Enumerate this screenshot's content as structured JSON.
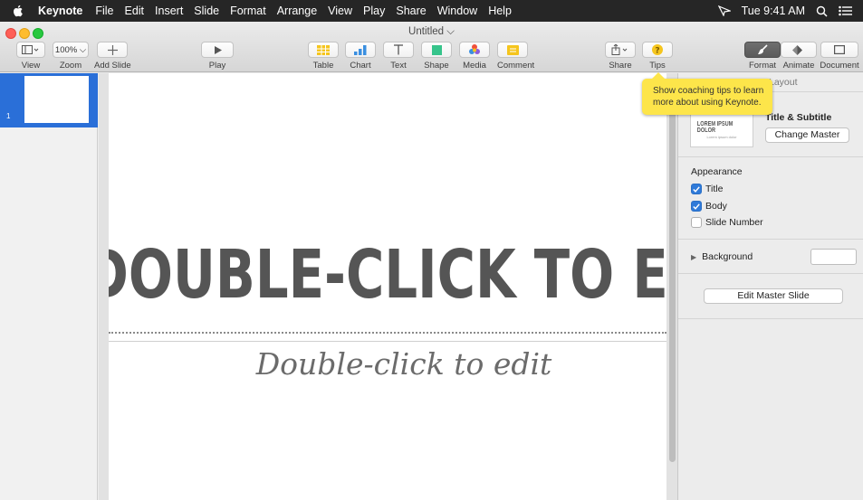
{
  "menubar": {
    "items": [
      "Keynote",
      "File",
      "Edit",
      "Insert",
      "Slide",
      "Format",
      "Arrange",
      "View",
      "Play",
      "Share",
      "Window",
      "Help"
    ],
    "clock": "Tue 9:41 AM"
  },
  "window": {
    "title": "Untitled ⌵"
  },
  "toolbar": {
    "view_label": "View",
    "zoom_value": "100% ⌵",
    "zoom_label": "Zoom",
    "add_slide_label": "Add Slide",
    "play_label": "Play",
    "table_label": "Table",
    "chart_label": "Chart",
    "text_label": "Text",
    "shape_label": "Shape",
    "media_label": "Media",
    "comment_label": "Comment",
    "share_label": "Share",
    "tips_label": "Tips",
    "format_label": "Format",
    "animate_label": "Animate",
    "document_label": "Document"
  },
  "navigator": {
    "slide_number": "1"
  },
  "slide": {
    "title": "DOUBLE-CLICK TO EDIT",
    "subtitle": "Double-click to edit"
  },
  "tooltip": {
    "text": "Show coaching tips to learn more about using Keynote."
  },
  "inspector": {
    "tab_label": "Layout",
    "master_thumb_title": "LOREM IPSUM DOLOR",
    "master_thumb_sub": "Lorem ipsum dolor",
    "master_name": "Title & Subtitle",
    "change_master_label": "Change Master",
    "appearance_heading": "Appearance",
    "checkboxes": [
      {
        "label": "Title",
        "checked": true
      },
      {
        "label": "Body",
        "checked": true
      },
      {
        "label": "Slide Number",
        "checked": false
      }
    ],
    "background_label": "Background",
    "edit_master_label": "Edit Master Slide"
  },
  "colors": {
    "accent": "#2a6fd8",
    "tooltip": "#fde54a",
    "menubar": "#262626"
  }
}
